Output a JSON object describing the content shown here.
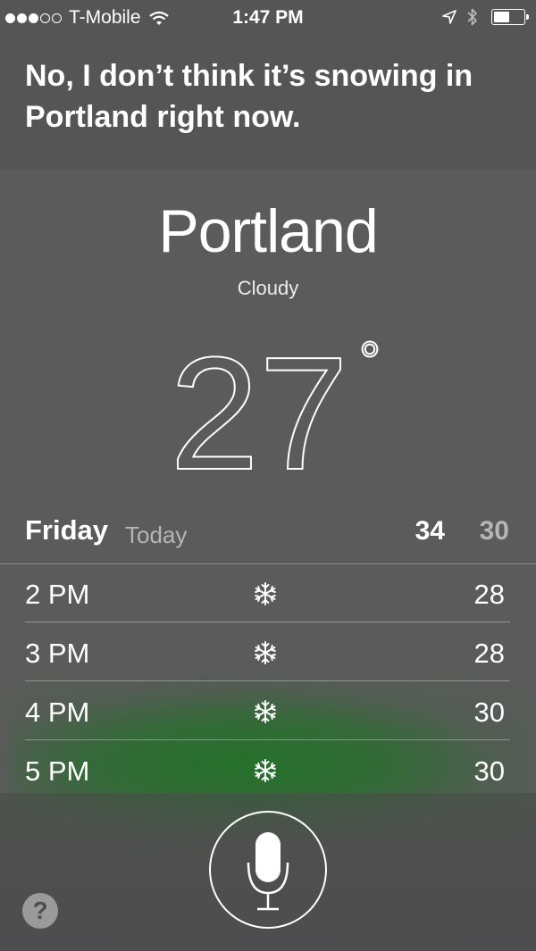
{
  "status_bar": {
    "signal_filled": 3,
    "signal_total": 5,
    "carrier": "T-Mobile",
    "time": "1:47 PM",
    "battery_level": 0.55
  },
  "siri": {
    "response": "No, I don’t think it’s snowing in Portland right now."
  },
  "weather": {
    "city": "Portland",
    "condition": "Cloudy",
    "temperature": "27",
    "degree_symbol": "°",
    "day": {
      "name": "Friday",
      "label": "Today",
      "high": "34",
      "low": "30"
    },
    "hourly": [
      {
        "time": "2 PM",
        "icon": "snowflake-icon",
        "temp": "28"
      },
      {
        "time": "3 PM",
        "icon": "snowflake-icon",
        "temp": "28"
      },
      {
        "time": "4 PM",
        "icon": "snowflake-icon",
        "temp": "30"
      },
      {
        "time": "5 PM",
        "icon": "snowflake-icon",
        "temp": "30"
      }
    ]
  },
  "controls": {
    "help_label": "?",
    "mic_icon": "microphone-icon"
  },
  "colors": {
    "background": "#5b5b5b",
    "top_band": "#555555",
    "glow": "#2a7a30",
    "muted_text": "#b5b5b5"
  }
}
